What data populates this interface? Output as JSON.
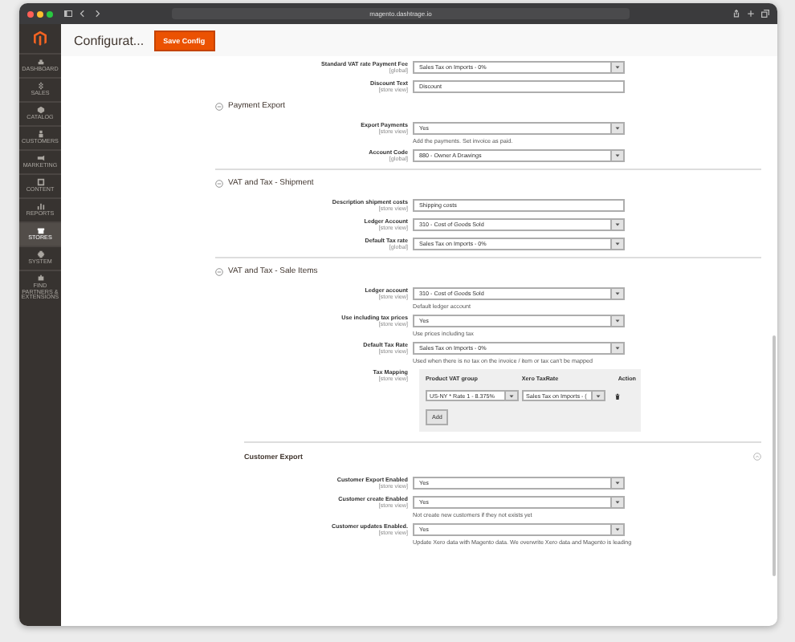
{
  "browser": {
    "url": "magento.dashtrage.io"
  },
  "sidebar": {
    "items": [
      {
        "label": "DASHBOARD",
        "selected": false
      },
      {
        "label": "SALES",
        "selected": false
      },
      {
        "label": "CATALOG",
        "selected": false
      },
      {
        "label": "CUSTOMERS",
        "selected": false
      },
      {
        "label": "MARKETING",
        "selected": false
      },
      {
        "label": "CONTENT",
        "selected": false
      },
      {
        "label": "REPORTS",
        "selected": false
      },
      {
        "label": "STORES",
        "selected": true
      },
      {
        "label": "SYSTEM",
        "selected": false
      },
      {
        "label": "FIND PARTNERS & EXTENSIONS",
        "selected": false
      }
    ]
  },
  "page": {
    "title": "Configurat...",
    "save_button": "Save Config"
  },
  "blocks": [
    {
      "kind": "fields",
      "fields": [
        {
          "kind": "select",
          "label": "Standard VAT rate Payment Fee",
          "scope": "[global]",
          "value": "Sales Tax on Imports - 0%"
        },
        {
          "kind": "input",
          "label": "Discount Text",
          "scope": "[store view]",
          "value": "Discount"
        }
      ]
    },
    {
      "kind": "section",
      "title": "Payment Export",
      "expanded": true,
      "fields": [
        {
          "kind": "select",
          "label": "Export Payments",
          "scope": "[store view]",
          "value": "Yes",
          "note": "Add the payments. Set invoice as paid."
        },
        {
          "kind": "select",
          "label": "Account Code",
          "scope": "[global]",
          "value": "880 - Owner A Drawings"
        }
      ]
    },
    {
      "kind": "section",
      "title": "VAT and Tax - Shipment",
      "expanded": true,
      "fields": [
        {
          "kind": "input",
          "label": "Description shipment costs",
          "scope": "[store view]",
          "value": "Shipping costs"
        },
        {
          "kind": "select",
          "label": "Ledger Account",
          "scope": "[store view]",
          "value": "310 - Cost of Goods Sold"
        },
        {
          "kind": "select",
          "label": "Default Tax rate",
          "scope": "[global]",
          "value": "Sales Tax on Imports - 0%"
        }
      ]
    },
    {
      "kind": "section",
      "title": "VAT and Tax - Sale Items",
      "expanded": true,
      "fields": [
        {
          "kind": "select",
          "label": "Ledger account",
          "scope": "[store view]",
          "value": "310 - Cost of Goods Sold",
          "note": "Default ledger account"
        },
        {
          "kind": "select",
          "label": "Use including tax prices",
          "scope": "[store view]",
          "value": "Yes",
          "note": "Use prices including tax"
        },
        {
          "kind": "select",
          "label": "Default Tax Rate",
          "scope": "[store view]",
          "value": "Sales Tax on Imports - 0%",
          "note": "Used when there is no tax on the invoice / item or tax can't be mapped"
        },
        {
          "kind": "mapping",
          "label": "Tax Mapping",
          "scope": "[store view]",
          "columns": [
            "Product VAT group",
            "Xero TaxRate",
            "Action"
          ],
          "rows": [
            {
              "cells": [
                "US-NY * Rate 1 - 8.375%",
                "Sales Tax on Imports - ("
              ]
            }
          ],
          "add_button": "Add"
        }
      ]
    },
    {
      "kind": "group",
      "title": "Customer Export",
      "expanded": true,
      "fields": [
        {
          "kind": "select",
          "label": "Customer Export Enabled",
          "scope": "[store view]",
          "value": "Yes"
        },
        {
          "kind": "select",
          "label": "Customer create Enabled",
          "scope": "[store view]",
          "value": "Yes",
          "note": "Not create new customers if they not exists yet"
        },
        {
          "kind": "select",
          "label": "Customer updates Enabled.",
          "scope": "[store view]",
          "value": "Yes",
          "note": "Update Xero data with Magento data. We overwrite Xero data and Magento is leading"
        }
      ]
    }
  ]
}
